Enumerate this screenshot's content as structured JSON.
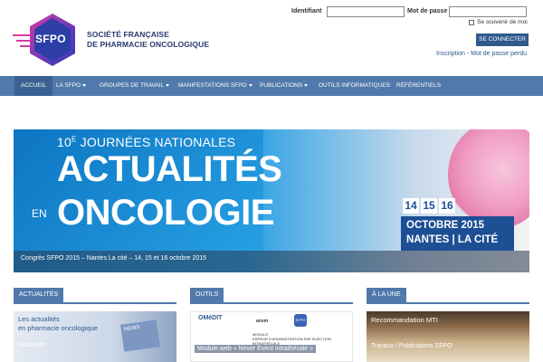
{
  "header": {
    "logo_mark": "SFPO",
    "logo_line1": "SOCIÉTÉ FRANÇAISE",
    "logo_line2": "DE PHARMACIE ONCOLOGIQUE",
    "login": {
      "identifier_label": "Identifiant",
      "password_label": "Mot de passe",
      "remember_label": "Se souvenir de moi",
      "connect_label": "SE CONNECTER",
      "register_link": "Inscription",
      "separator": " - ",
      "lost_password_link": "Mot de passe perdu"
    }
  },
  "nav": {
    "items": [
      {
        "label": "ACCUEIL",
        "active": true
      },
      {
        "label": "LA SFPO",
        "dropdown": true
      },
      {
        "label": "GROUPES DE TRAVAIL",
        "dropdown": true
      },
      {
        "label": "MANIFESTATIONS SFPO",
        "dropdown": true
      },
      {
        "label": "PUBLICATIONS",
        "dropdown": true
      },
      {
        "label": "OUTILS INFORMATIQUES"
      },
      {
        "label": "RÉFÉRENTIELS"
      }
    ]
  },
  "banner": {
    "ordinal": "10",
    "ordinal_sup": "E",
    "headline_top": " JOURNÉES NATIONALES",
    "headline_big1": "ACTUALITÉS",
    "headline_en": "EN",
    "headline_big2": "ONCOLOGIE",
    "days": [
      "14",
      "15",
      "16"
    ],
    "month_year": "OCTOBRE 2015",
    "place": "NANTES | LA CITÉ",
    "caption": "Congrès SFPO 2015 – Nantes La cité – 14, 15 et 16 octobre 2015"
  },
  "columns": {
    "actualites": {
      "tab": "ACTUALITÉS",
      "title_line1": "Les actualités",
      "title_line2": "en pharmacie oncologique",
      "card": "NEWS",
      "subtitle": "Actualités"
    },
    "outils": {
      "tab": "OUTILS",
      "logo1": "OMéDIT",
      "logo2": "ansm",
      "logo_sfpo": "SFPO",
      "module_label": "MODULE",
      "module_text": "ERREUR D'ADMINISTRATION PAR INJECTION INTRATHÉCALE",
      "caption": "Module web « Never Event intrathécale »"
    },
    "une": {
      "tab": "À LA UNE",
      "title": "Recommandation MTI",
      "subtitle": "Travaux / Publications SFPO"
    }
  },
  "colors": {
    "nav_bg": "#5179ab",
    "nav_active": "#3a6191",
    "brand_blue": "#2a3a6e",
    "button": "#2f5a8c",
    "banner_blue": "#1a8ad4",
    "date_bar": "#1d4f95"
  }
}
